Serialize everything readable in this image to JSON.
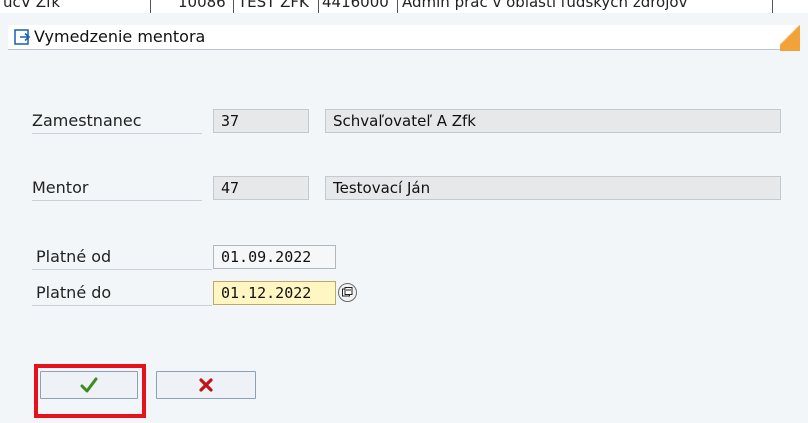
{
  "background_row": {
    "col1": "ucV Zfk",
    "col2": "10086",
    "col3": "TEST ZFK",
    "col4": "4416000",
    "col5": "Admin prác v oblasti ľudských zdrojov"
  },
  "dialog": {
    "title": "Vymedzenie mentora"
  },
  "form": {
    "employee": {
      "label": "Zamestnanec",
      "id": "37",
      "name": "Schvaľovateľ A Zfk"
    },
    "mentor": {
      "label": "Mentor",
      "id": "47",
      "name": "Testovací Ján"
    },
    "valid_from": {
      "label": "Platné od",
      "value": "01.09.2022"
    },
    "valid_to": {
      "label": "Platné do",
      "value": "01.12.2022"
    }
  },
  "buttons": {
    "confirm_icon": "checkmark-icon",
    "cancel_icon": "cross-icon"
  },
  "colors": {
    "highlight": "#e5121c",
    "title_accent": "#f1a33a",
    "active_field": "#fff6c2"
  }
}
